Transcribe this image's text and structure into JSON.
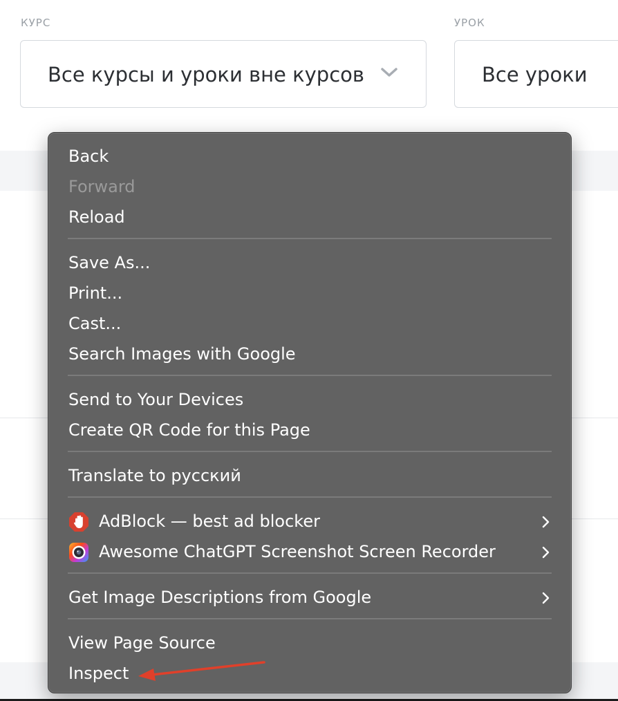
{
  "filters": {
    "course": {
      "label": "КУРС",
      "value": "Все курсы и уроки вне курсов"
    },
    "lesson": {
      "label": "УРОК",
      "value": "Все уроки"
    }
  },
  "context_menu": {
    "items": {
      "back": "Back",
      "forward": "Forward",
      "reload": "Reload",
      "save_as": "Save As...",
      "print": "Print...",
      "cast": "Cast...",
      "search_images": "Search Images with Google",
      "send_to_devices": "Send to Your Devices",
      "create_qr": "Create QR Code for this Page",
      "translate": "Translate to русский",
      "adblock": "AdBlock — best ad blocker",
      "awesome_screenshot": "Awesome ChatGPT Screenshot  Screen Recorder",
      "image_descriptions": "Get Image Descriptions from Google",
      "view_source": "View Page Source",
      "inspect": "Inspect"
    },
    "icons": {
      "adblock": "adblock-hand-icon",
      "awesome_screenshot": "camera-lens-icon",
      "submenu": "chevron-right-icon"
    }
  },
  "colors": {
    "menu_background": "#626262",
    "menu_text": "#ffffff",
    "menu_disabled_text": "#9a9a9a",
    "annotation_arrow": "#e0402a",
    "adblock_red": "#d8412f"
  }
}
